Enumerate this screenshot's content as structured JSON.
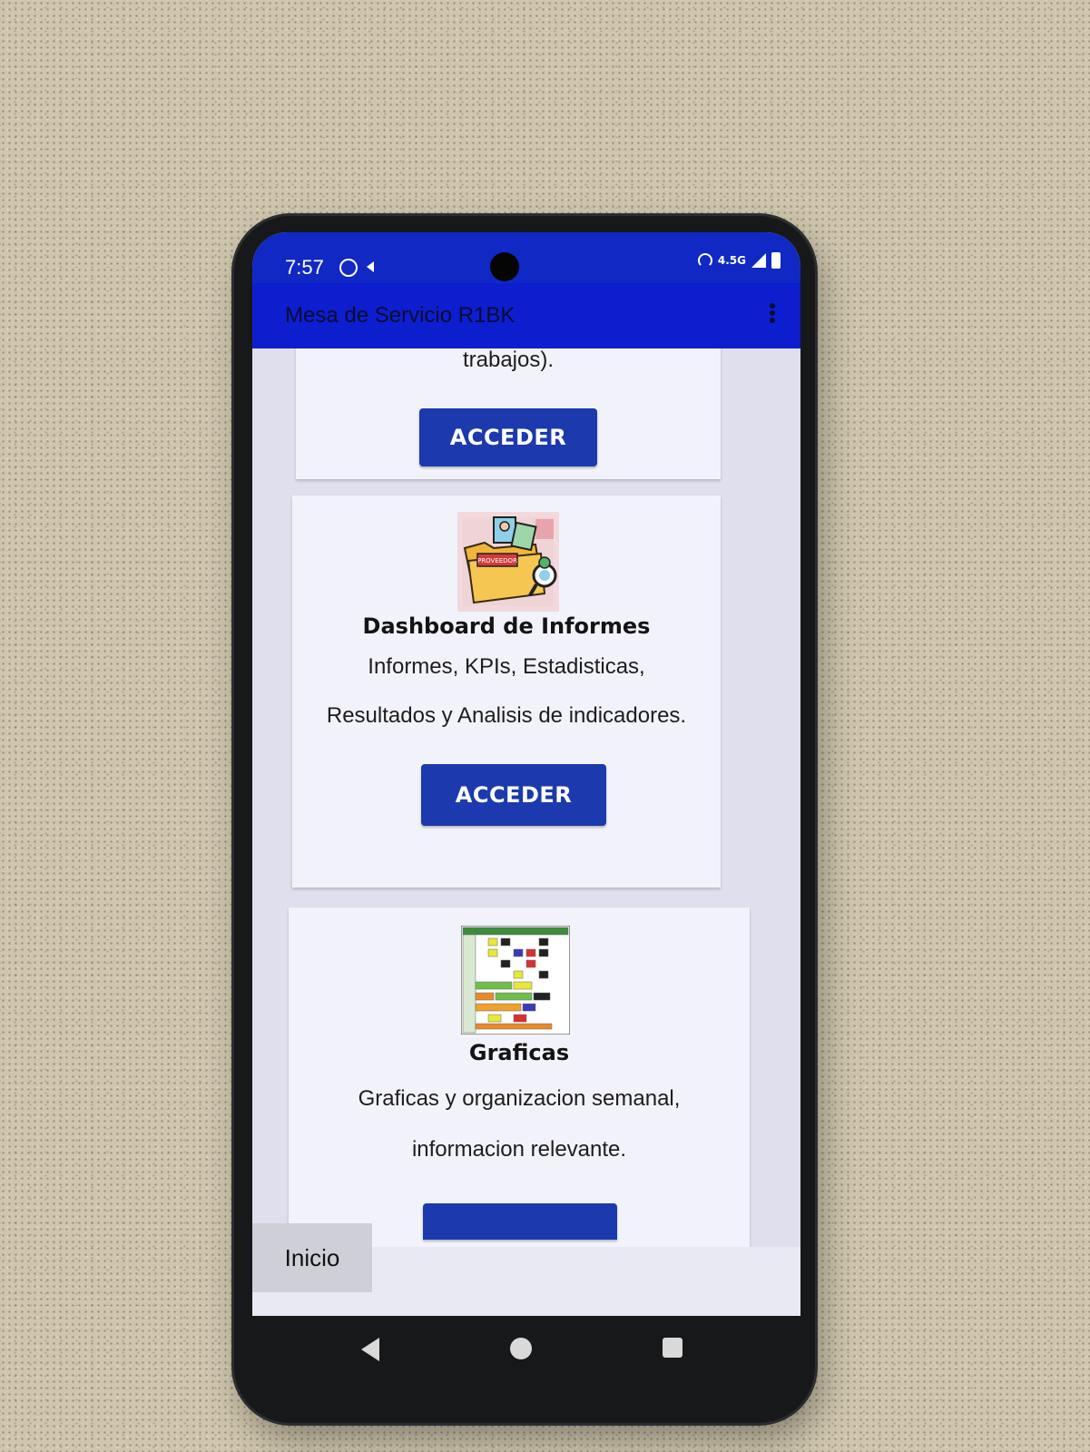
{
  "status_bar": {
    "time": "7:57",
    "network": "4.5G",
    "icons": [
      "whatsapp-icon",
      "notification-arrow-icon",
      "hotspot-icon",
      "signal-icon",
      "battery-icon"
    ]
  },
  "app_bar": {
    "title": "Mesa de Servicio R1BK",
    "menu_icon": "more-vert-icon"
  },
  "cards": [
    {
      "title": "",
      "description_lines": [
        "trabajos)."
      ],
      "button_label": "ACCEDER"
    },
    {
      "title": "Dashboard de Informes",
      "description_lines": [
        "Informes, KPIs, Estadisticas,",
        "Resultados y Analisis de indicadores."
      ],
      "button_label": "ACCEDER",
      "image_text": "PROVEEDOR"
    },
    {
      "title": "Graficas",
      "description_lines": [
        "Graficas y organizacion semanal,",
        "informacion relevante."
      ],
      "button_label": ""
    }
  ],
  "bottom_tab": {
    "label": "Inicio"
  },
  "colors": {
    "status_bar": "#1128c4",
    "app_bar": "#0d1ecf",
    "button": "#1c3aae",
    "card": "#f2f2fb"
  },
  "nav_icons": [
    "back-icon",
    "home-icon",
    "recents-icon"
  ]
}
